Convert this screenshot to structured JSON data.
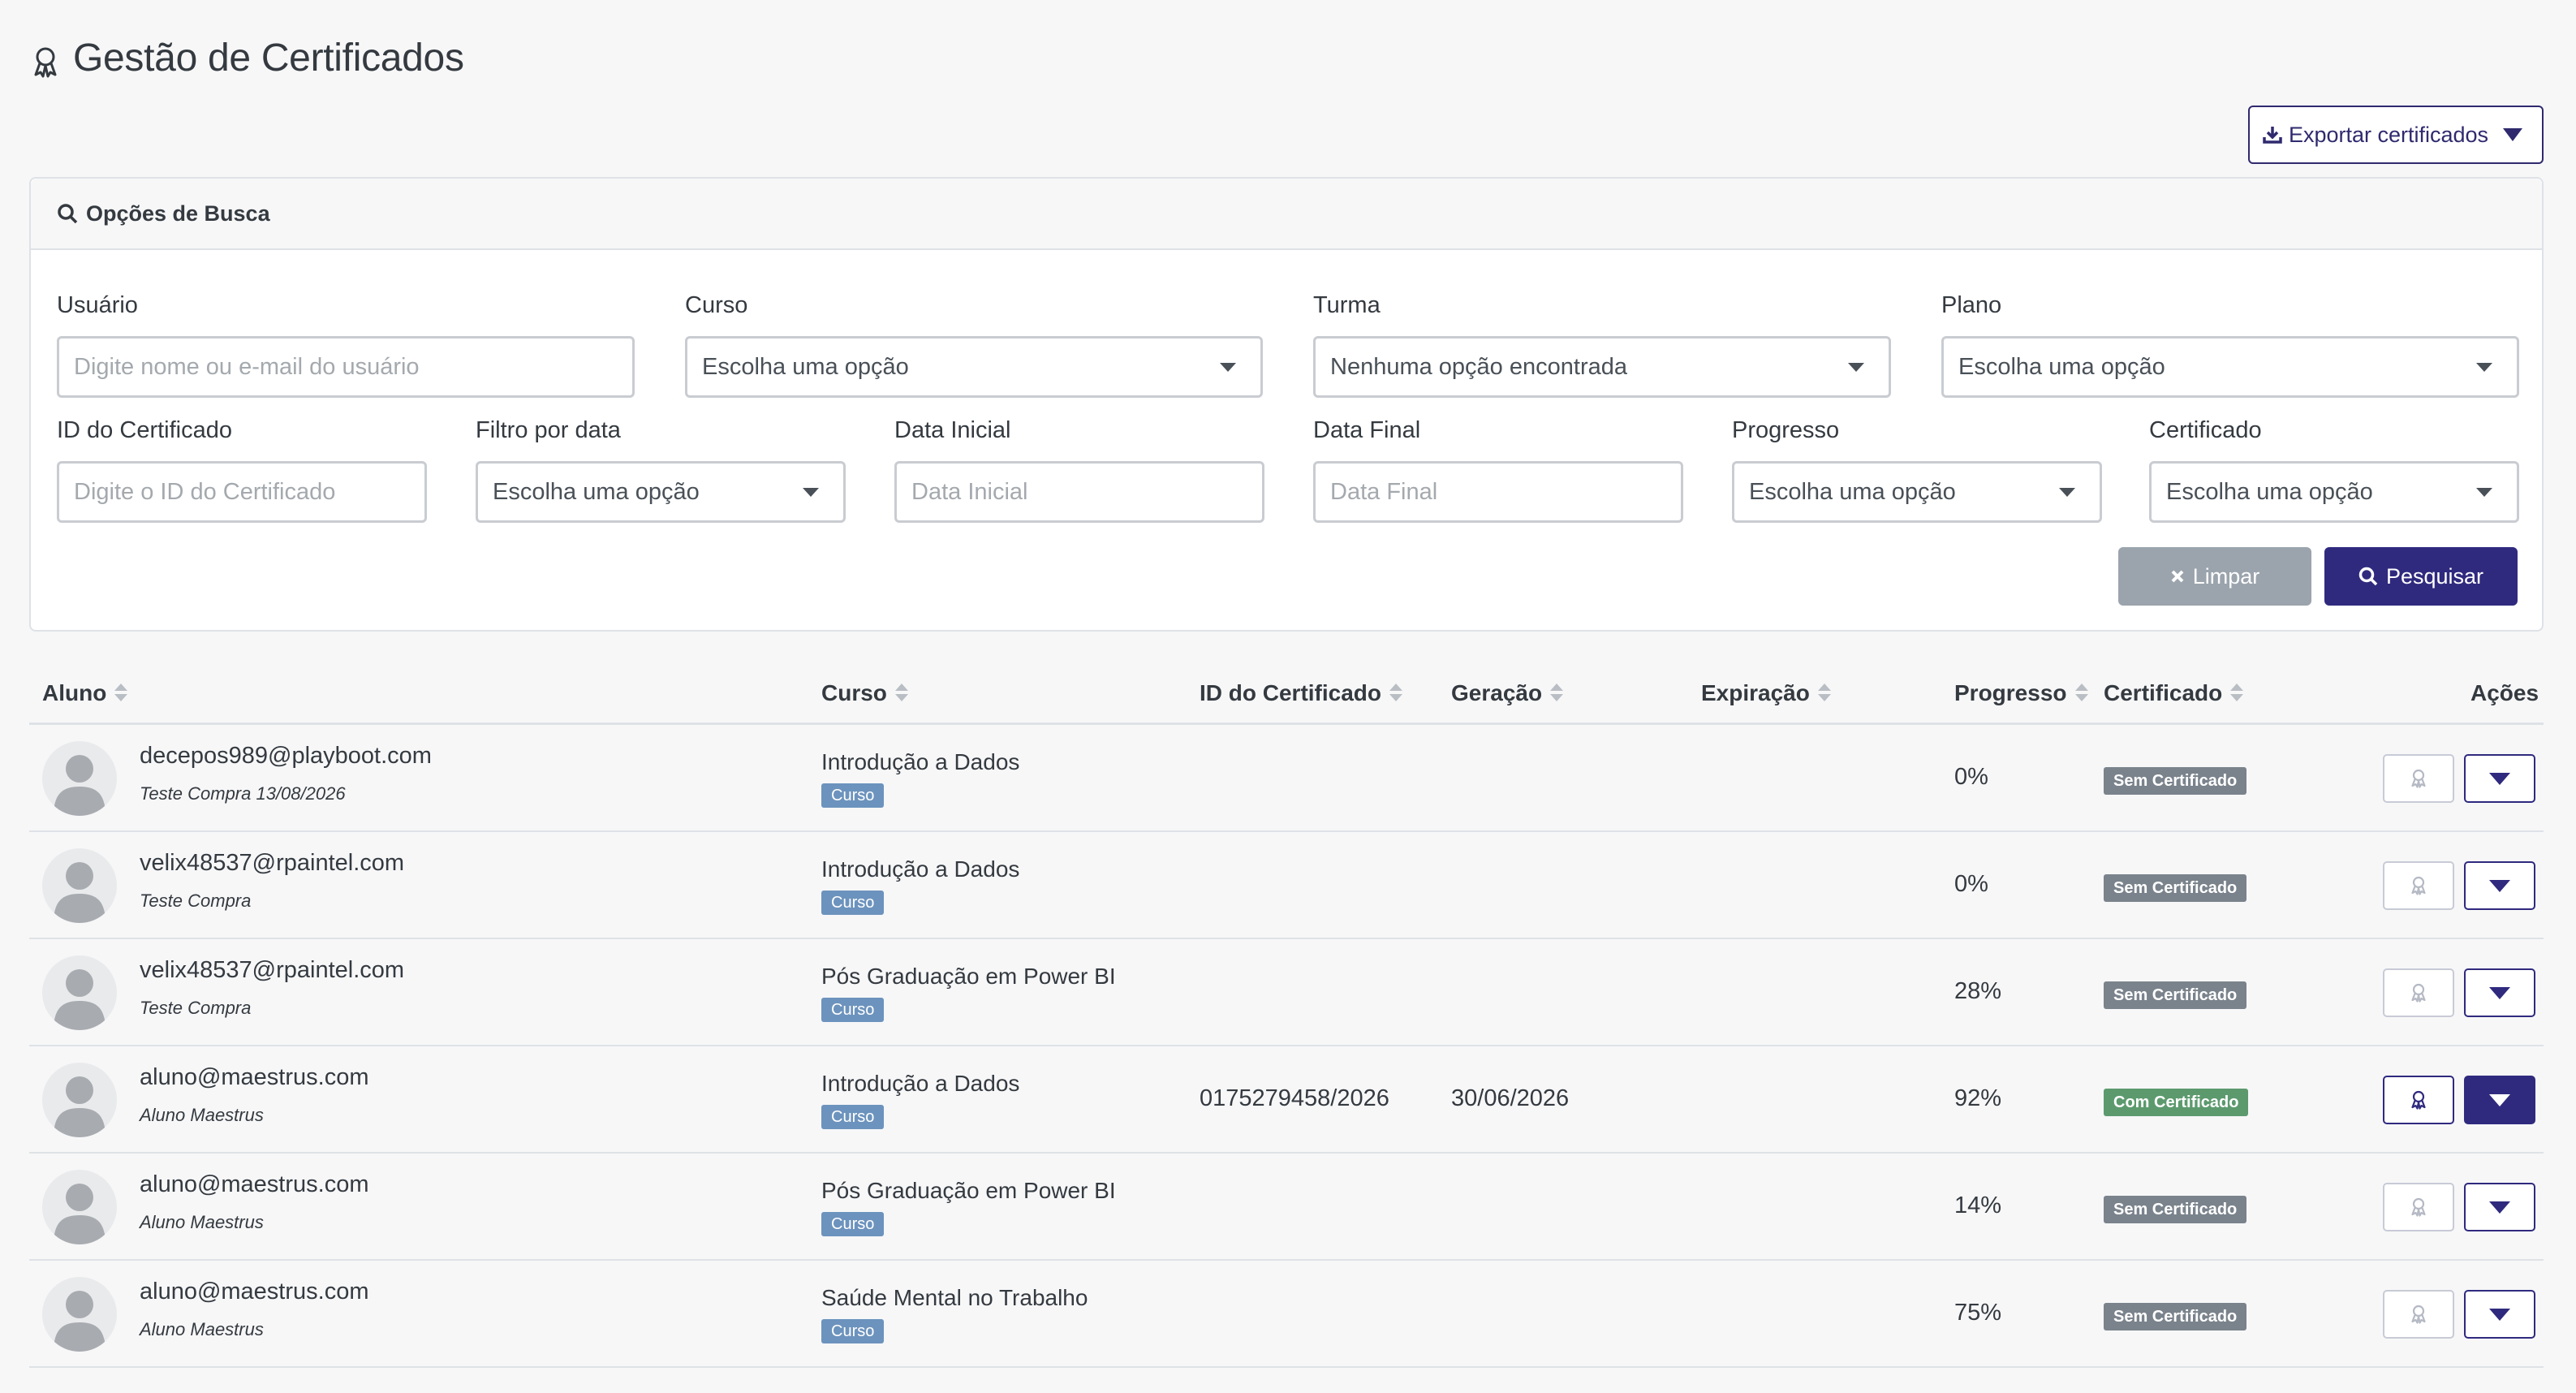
{
  "page": {
    "title": "Gestão de Certificados"
  },
  "toolbar": {
    "export_label": "Exportar certificados"
  },
  "colors": {
    "accent": "#2f2a7e",
    "sem_certificado": "#7a838c",
    "com_certificado": "#5c9a6e",
    "curso_badge": "#6c93bd"
  },
  "search": {
    "header": "Opções de Busca",
    "usuario": {
      "label": "Usuário",
      "placeholder": "Digite nome ou e-mail do usuário"
    },
    "curso": {
      "label": "Curso",
      "value": "Escolha uma opção"
    },
    "turma": {
      "label": "Turma",
      "value": "Nenhuma opção encontrada"
    },
    "plano": {
      "label": "Plano",
      "value": "Escolha uma opção"
    },
    "id_certificado": {
      "label": "ID do Certificado",
      "placeholder": "Digite o ID do Certificado"
    },
    "filtro_data": {
      "label": "Filtro por data",
      "value": "Escolha uma opção"
    },
    "data_inicial": {
      "label": "Data Inicial",
      "placeholder": "Data Inicial"
    },
    "data_final": {
      "label": "Data Final",
      "placeholder": "Data Final"
    },
    "progresso": {
      "label": "Progresso",
      "value": "Escolha uma opção"
    },
    "certificado": {
      "label": "Certificado",
      "value": "Escolha uma opção"
    },
    "clear_label": "Limpar",
    "search_label": "Pesquisar"
  },
  "table": {
    "columns": {
      "aluno": "Aluno",
      "curso": "Curso",
      "id_certificado": "ID do Certificado",
      "geracao": "Geração",
      "expiracao": "Expiração",
      "progresso": "Progresso",
      "certificado": "Certificado",
      "acoes": "Ações"
    },
    "rows": [
      {
        "email": "decepos989@playboot.com",
        "plan": "Teste Compra 13/08/2026",
        "course": "Introdução a Dados",
        "type": "Curso",
        "cert_id": "",
        "generated": "",
        "expires": "",
        "progress": "0%",
        "cert_status": "Sem Certificado"
      },
      {
        "email": "velix48537@rpaintel.com",
        "plan": "Teste Compra",
        "course": "Introdução a Dados",
        "type": "Curso",
        "cert_id": "",
        "generated": "",
        "expires": "",
        "progress": "0%",
        "cert_status": "Sem Certificado"
      },
      {
        "email": "velix48537@rpaintel.com",
        "plan": "Teste Compra",
        "course": "Pós Graduação em Power BI",
        "type": "Curso",
        "cert_id": "",
        "generated": "",
        "expires": "",
        "progress": "28%",
        "cert_status": "Sem Certificado"
      },
      {
        "email": "aluno@maestrus.com",
        "plan": "Aluno Maestrus",
        "course": "Introdução a Dados",
        "type": "Curso",
        "cert_id": "0175279458/2026",
        "generated": "30/06/2026",
        "expires": "",
        "progress": "92%",
        "cert_status": "Com Certificado"
      },
      {
        "email": "aluno@maestrus.com",
        "plan": "Aluno Maestrus",
        "course": "Pós Graduação em Power BI",
        "type": "Curso",
        "cert_id": "",
        "generated": "",
        "expires": "",
        "progress": "14%",
        "cert_status": "Sem Certificado"
      },
      {
        "email": "aluno@maestrus.com",
        "plan": "Aluno Maestrus",
        "course": "Saúde Mental no Trabalho",
        "type": "Curso",
        "cert_id": "",
        "generated": "",
        "expires": "",
        "progress": "75%",
        "cert_status": "Sem Certificado"
      }
    ]
  }
}
